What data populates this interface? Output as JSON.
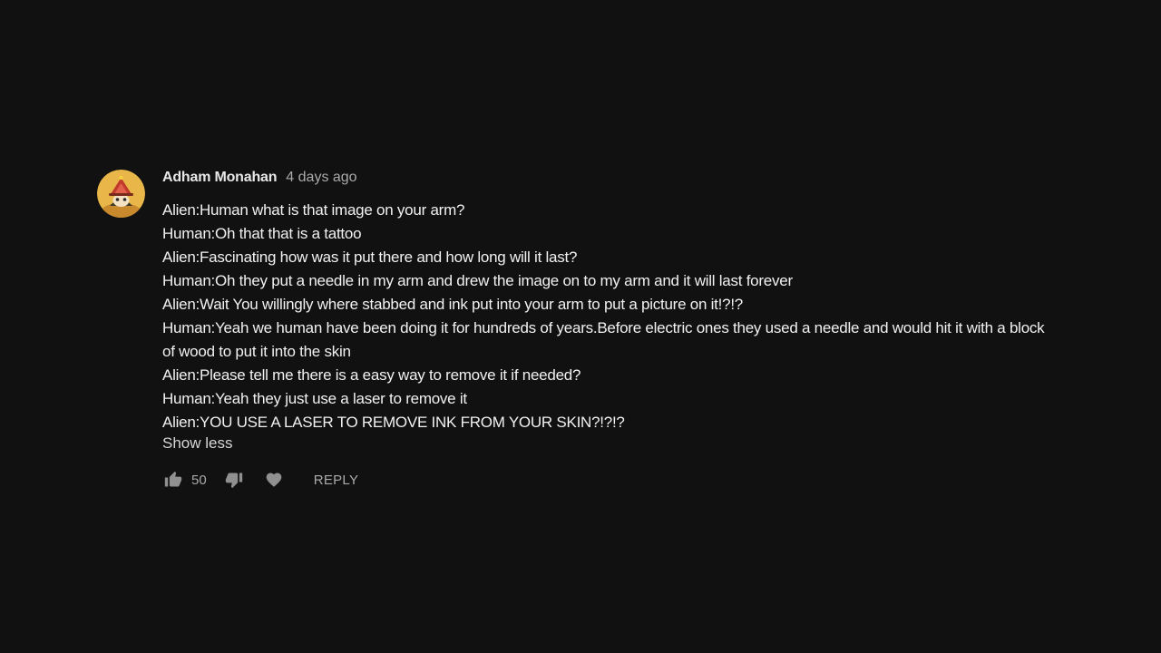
{
  "comment": {
    "author": "Adham Monahan",
    "timestamp": "4 days ago",
    "avatar_icon": "avatar-image",
    "lines": [
      "Alien:Human what is that image on your arm?",
      "Human:Oh that that is a tattoo",
      "Alien:Fascinating how was it put there and how long will it last?",
      "Human:Oh they put a needle in my arm and drew the image on to my arm and it will last forever",
      "Alien:Wait You willingly where stabbed and ink put into your arm to put a picture on it!?!?",
      "Human:Yeah we human have been doing it for hundreds of years.Before electric ones they used a needle and would hit it with a block of wood to put it into the skin",
      "Alien:Please tell me there is a easy way to remove it if needed?",
      "Human:Yeah they just use a laser to remove it",
      "Alien:YOU USE A LASER TO REMOVE INK FROM YOUR SKIN?!?!?"
    ],
    "show_less_label": "Show less",
    "like_count": "50",
    "reply_label": "REPLY"
  },
  "colors": {
    "background": "#111111",
    "text": "#f1f1f1",
    "secondary_text": "#aaaaaa",
    "icon": "#909090"
  },
  "icons": {
    "like": "thumb-up-icon",
    "dislike": "thumb-down-icon",
    "heart": "heart-icon"
  }
}
